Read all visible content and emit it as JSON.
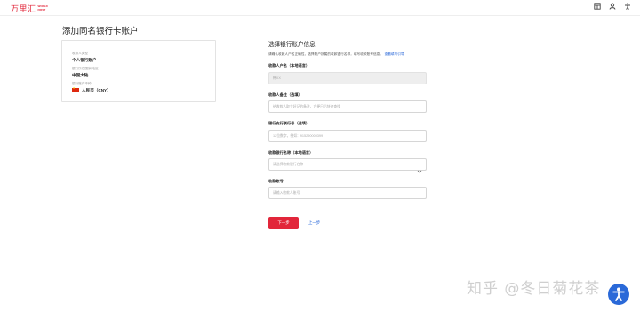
{
  "app": {
    "logo_cn": "万里汇",
    "logo_en_line1": "WORLD",
    "logo_en_line2": "FIRST"
  },
  "topbar_icons": [
    "layout-icon",
    "user-icon",
    "accessibility-icon"
  ],
  "page": {
    "title": "添加同名银行卡账户"
  },
  "summary": {
    "account_type_label": "收款人类型",
    "account_type_value": "个人银行账户",
    "region_label": "银行所在国家/地区",
    "region_value": "中国大陆",
    "currency_label": "银行账户币种",
    "currency_value": "人民币（CNY）"
  },
  "form": {
    "heading": "选择银行账户信息",
    "hint": "请确认收款人户名正确性，选择账户所属的收款银行名称，填写收款账号信息。",
    "hint_link": "查看填写引导",
    "fields": {
      "holder_name": {
        "label": "收款人户名（本地语言）",
        "value": "韩XX"
      },
      "remark": {
        "label": "收款人备注（选填）",
        "placeholder": "给收款人取个好记的备注，方便日后快速查找"
      },
      "branch_code": {
        "label": "银行支行联行号（选填）",
        "placeholder": "12位数字，例如：915290000399"
      },
      "bank_name": {
        "label": "收款银行名称（本地语言）",
        "placeholder": "请选择收款银行名称"
      },
      "account_no": {
        "label": "收款账号",
        "placeholder": "请输入收款人账号"
      }
    }
  },
  "actions": {
    "next": "下一步",
    "prev": "上一步"
  },
  "watermark": "知乎 @冬日菊花茶",
  "colors": {
    "brand_red": "#e2263a",
    "link_blue": "#1d5fd6"
  }
}
